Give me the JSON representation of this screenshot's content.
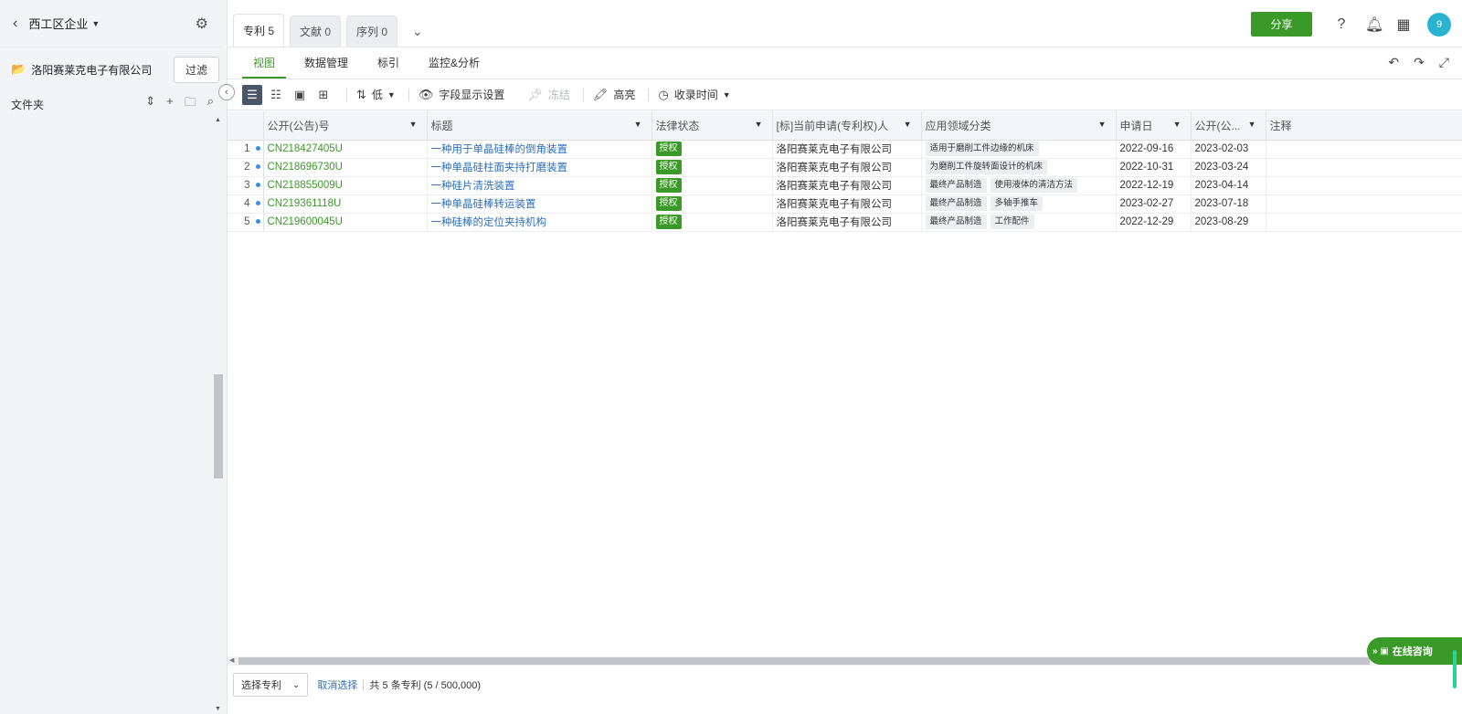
{
  "sidebar": {
    "title": "西工区企业",
    "company": "洛阳赛莱克电子有限公司",
    "filter_label": "过滤",
    "folder_label": "文件夹"
  },
  "tabs": [
    {
      "label": "专利 5"
    },
    {
      "label": "文献 0"
    },
    {
      "label": "序列 0"
    }
  ],
  "header": {
    "share_label": "分享",
    "avatar_text": "9"
  },
  "subnav": [
    "视图",
    "数据管理",
    "标引",
    "监控&分析"
  ],
  "toolbar": {
    "sort_label": "低",
    "fields_label": "字段显示设置",
    "freeze_label": "冻结",
    "highlight_label": "高亮",
    "time_label": "收录时间"
  },
  "table": {
    "headers": [
      "公开(公告)号",
      "标题",
      "法律状态",
      "[标]当前申请(专利权)人",
      "应用领域分类",
      "申请日",
      "公开(公...",
      "注释"
    ],
    "rows": [
      {
        "n": "1",
        "pn": "CN218427405U",
        "title": "一种用于单晶硅棒的倒角装置",
        "status": "授权",
        "applicant": "洛阳赛莱克电子有限公司",
        "tags": [
          "适用于磨削工件边缘的机床"
        ],
        "app_date": "2022-09-16",
        "pub_date": "2023-02-03"
      },
      {
        "n": "2",
        "pn": "CN218696730U",
        "title": "一种单晶硅柱面夹持打磨装置",
        "status": "授权",
        "applicant": "洛阳赛莱克电子有限公司",
        "tags": [
          "为磨削工件旋转面设计的机床"
        ],
        "app_date": "2022-10-31",
        "pub_date": "2023-03-24"
      },
      {
        "n": "3",
        "pn": "CN218855009U",
        "title": "一种硅片清洗装置",
        "status": "授权",
        "applicant": "洛阳赛莱克电子有限公司",
        "tags": [
          "最终产品制造",
          "使用液体的清洁方法"
        ],
        "app_date": "2022-12-19",
        "pub_date": "2023-04-14"
      },
      {
        "n": "4",
        "pn": "CN219361118U",
        "title": "一种单晶硅棒转运装置",
        "status": "授权",
        "applicant": "洛阳赛莱克电子有限公司",
        "tags": [
          "最终产品制造",
          "多轴手推车"
        ],
        "app_date": "2023-02-27",
        "pub_date": "2023-07-18"
      },
      {
        "n": "5",
        "pn": "CN219600045U",
        "title": "一种硅棒的定位夹持机构",
        "status": "授权",
        "applicant": "洛阳赛莱克电子有限公司",
        "tags": [
          "最终产品制造",
          "工作配件"
        ],
        "app_date": "2022-12-29",
        "pub_date": "2023-08-29"
      }
    ]
  },
  "footer": {
    "select_label": "选择专利",
    "cancel_label": "取消选择",
    "summary": "共 5 条专利 (5 / 500,000)"
  },
  "chat_label": "在线咨询"
}
